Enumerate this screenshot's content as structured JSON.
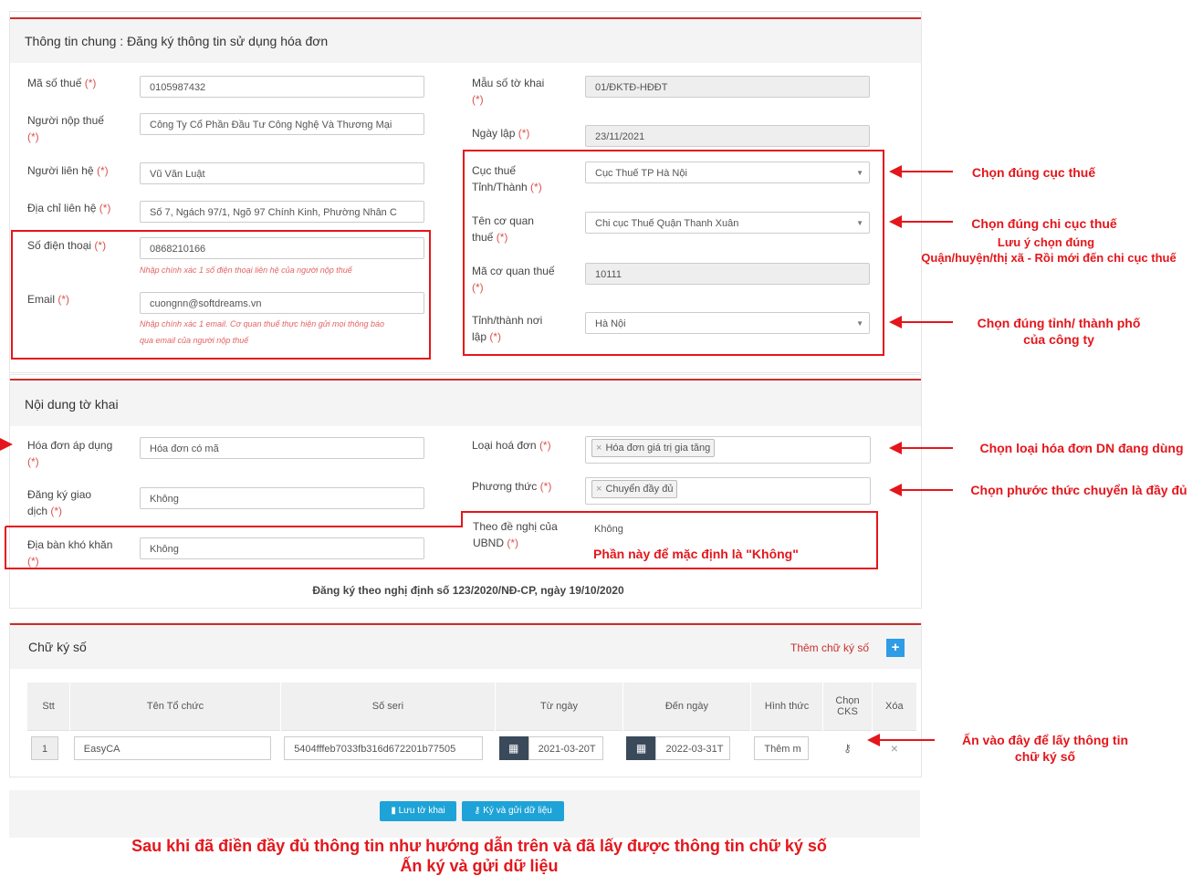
{
  "section1": {
    "title": "Thông tin chung : Đăng ký thông tin sử dụng hóa đơn",
    "fields": {
      "mst_label": "Mã số thuế",
      "mst_value": "0105987432",
      "nnt_label": "Người nộp thuế",
      "nnt_value": "Công Ty Cổ Phần Đầu Tư Công Nghệ Và Thương Mại",
      "nlh_label": "Người liên hệ",
      "nlh_value": "Vũ Văn Luật",
      "dc_label": "Địa chỉ liên hệ",
      "dc_value": "Số 7, Ngách 97/1, Ngõ 97 Chính Kinh, Phường Nhân C",
      "sdt_label": "Số điện thoại",
      "sdt_value": "0868210166",
      "sdt_hint": "Nhập chính xác 1 số điện thoại liên hệ của người nộp thuế",
      "email_label": "Email",
      "email_value": "cuongnn@softdreams.vn",
      "email_hint1": "Nhập chính xác 1 email. Cơ quan thuế thực hiện gửi mọi thông báo",
      "email_hint2": "qua email của người nộp thuế",
      "mau_label": "Mẫu số tờ khai",
      "mau_value": "01/ĐKTĐ-HĐĐT",
      "ngay_label": "Ngày lập",
      "ngay_value": "23/11/2021",
      "cuc_label1": "Cục thuế",
      "cuc_label2": "Tỉnh/Thành",
      "cuc_value": "Cục Thuế TP Hà Nội",
      "tcq_label1": "Tên cơ quan",
      "tcq_label2": "thuế",
      "tcq_value": "Chi cục Thuế Quận Thanh Xuân",
      "macq_label": "Mã cơ quan thuế",
      "macq_value": "10111",
      "tinh_label1": "Tỉnh/thành nơi",
      "tinh_label2": "lập",
      "tinh_value": "Hà Nội"
    }
  },
  "section2": {
    "title": "Nội dung tờ khai",
    "fields": {
      "hd_label1": "Hóa đơn áp dụng",
      "hd_value": "Hóa đơn có mã",
      "dk_label1": "Đăng ký giao",
      "dk_label2": "dịch",
      "dk_value": "Không",
      "db_label1": "Địa bàn khó khăn",
      "db_value": "Không",
      "loai_label": "Loại hoá đơn",
      "loai_value": "Hóa đơn giá trị gia tăng",
      "pt_label": "Phương thức",
      "pt_value": "Chuyển đầy đủ",
      "ubnd_label1": "Theo đề nghị của",
      "ubnd_label2": "UBND",
      "ubnd_value": "Không"
    },
    "note": "Đăng ký theo nghị định số 123/2020/NĐ-CP, ngày 19/10/2020"
  },
  "required_mark": "(*)",
  "section3": {
    "title": "Chữ ký số",
    "add_label": "Thêm chữ ký số",
    "add_icon": "+",
    "headers": [
      "Stt",
      "Tên Tổ chức",
      "Số seri",
      "Từ ngày",
      "Đến ngày",
      "Hình thức",
      "Chọn",
      "CKS",
      "Xóa"
    ],
    "row": {
      "stt": "1",
      "org": "EasyCA",
      "serial": "5404fffeb7033fb316d672201b77505",
      "from": "2021-03-20T",
      "to": "2022-03-31T",
      "form": "Thêm m",
      "select_icon": "key-icon",
      "delete": "×"
    }
  },
  "buttons": {
    "save": "Lưu tờ khai",
    "sign": "Ký và gửi dữ liệu"
  },
  "annotations": {
    "a1": "Chọn đúng cục thuế",
    "a2": "Chọn đúng chi cục thuế",
    "a2b": "Lưu ý chọn đúng",
    "a2c": "Quận/huyện/thị xã - Rồi mới đến chi cục thuế",
    "a3": "Chọn đúng tỉnh/ thành phố",
    "a3b": "của công ty",
    "a4": "Chọn loại hóa đơn DN đang dùng",
    "a5": "Chọn phước thức chuyển là đầy đủ",
    "a6": "Phần này để mặc định là \"Không\"",
    "a7": "Ấn vào đây để lấy thông tin",
    "a7b": "chữ ký số",
    "bottom1": "Sau khi đã điền đầy đủ thông tin như hướng dẫn trên và đã lấy được thông tin chữ ký số",
    "bottom2": "Ấn ký và gửi dữ liệu"
  }
}
